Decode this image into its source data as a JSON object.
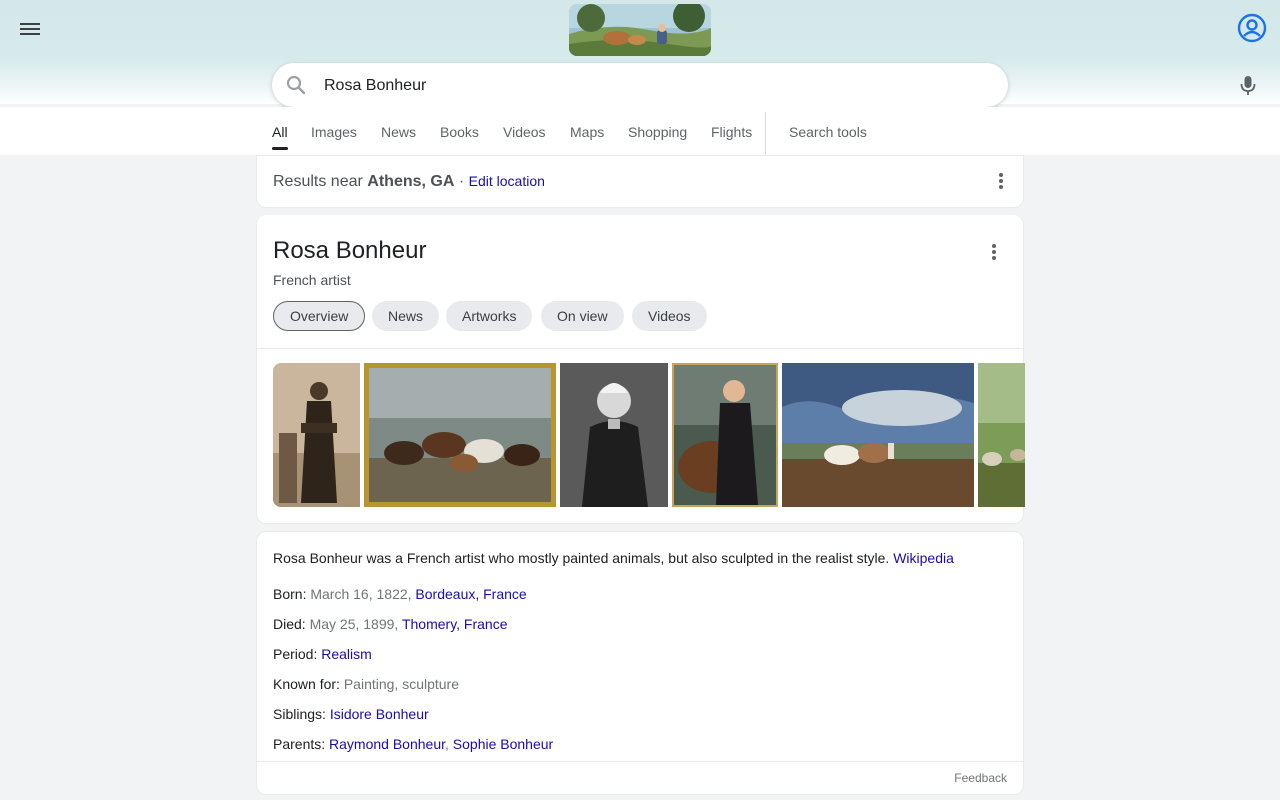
{
  "header": {
    "menu_icon": "hamburger-menu-icon",
    "doodle_icon": "doodle-painting-image",
    "account_icon": "account-circle-icon"
  },
  "search": {
    "query": "Rosa Bonheur",
    "search_icon": "magnifier-icon",
    "mic_icon": "microphone-icon"
  },
  "tabs": {
    "all": "All",
    "images": "Images",
    "news": "News",
    "books": "Books",
    "videos": "Videos",
    "maps": "Maps",
    "shopping": "Shopping",
    "flights": "Flights",
    "tools": "Search tools"
  },
  "location": {
    "prefix": "Results near",
    "place": "Athens, GA",
    "separator": "·",
    "edit": "Edit location"
  },
  "knowledge_panel": {
    "title": "Rosa Bonheur",
    "subtitle": "French artist",
    "chips": [
      "Overview",
      "News",
      "Artworks",
      "On view",
      "Videos"
    ]
  },
  "info": {
    "description": "Rosa Bonheur was a French artist who mostly painted animals, but also sculpted in the realist style.",
    "source": "Wikipedia",
    "born_label": "Born:",
    "born_date": "March 16, 1822,",
    "born_place": "Bordeaux, France",
    "died_label": "Died:",
    "died_date": "May 25, 1899,",
    "died_place": "Thomery, France",
    "period_label": "Period:",
    "period_value": "Realism",
    "known_label": "Known for:",
    "known_value": "Painting, sculpture",
    "siblings_label": "Siblings:",
    "siblings_value": "Isidore Bonheur",
    "parents_label": "Parents:",
    "parent1": "Raymond Bonheur",
    "parent_sep": ",",
    "parent2": "Sophie Bonheur",
    "feedback": "Feedback"
  },
  "colors": {
    "link": "#1a0dab",
    "header_bg": "#d4e8ea",
    "page_bg": "#f1f3f4",
    "chip_bg": "#e8eaed"
  }
}
